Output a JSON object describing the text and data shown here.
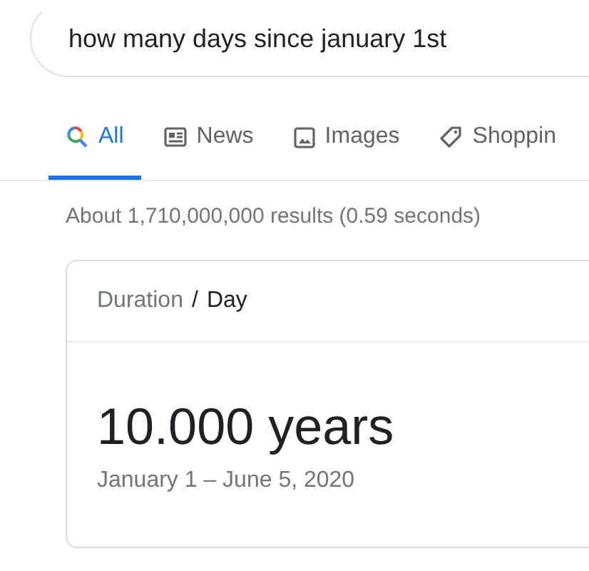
{
  "search": {
    "value": "how many days since january 1st"
  },
  "tabs": [
    {
      "label": "All",
      "kind": "all",
      "selected": true
    },
    {
      "label": "News",
      "kind": "news",
      "selected": false
    },
    {
      "label": "Images",
      "kind": "images",
      "selected": false
    },
    {
      "label": "Shoppin",
      "kind": "shopping",
      "selected": false
    }
  ],
  "result_stats": "About 1,710,000,000 results (0.59 seconds)",
  "card": {
    "breadcrumb": [
      "Duration",
      "Day"
    ],
    "separator": "/",
    "value": "10.000 years",
    "range": "January 1 – June 5, 2020"
  }
}
